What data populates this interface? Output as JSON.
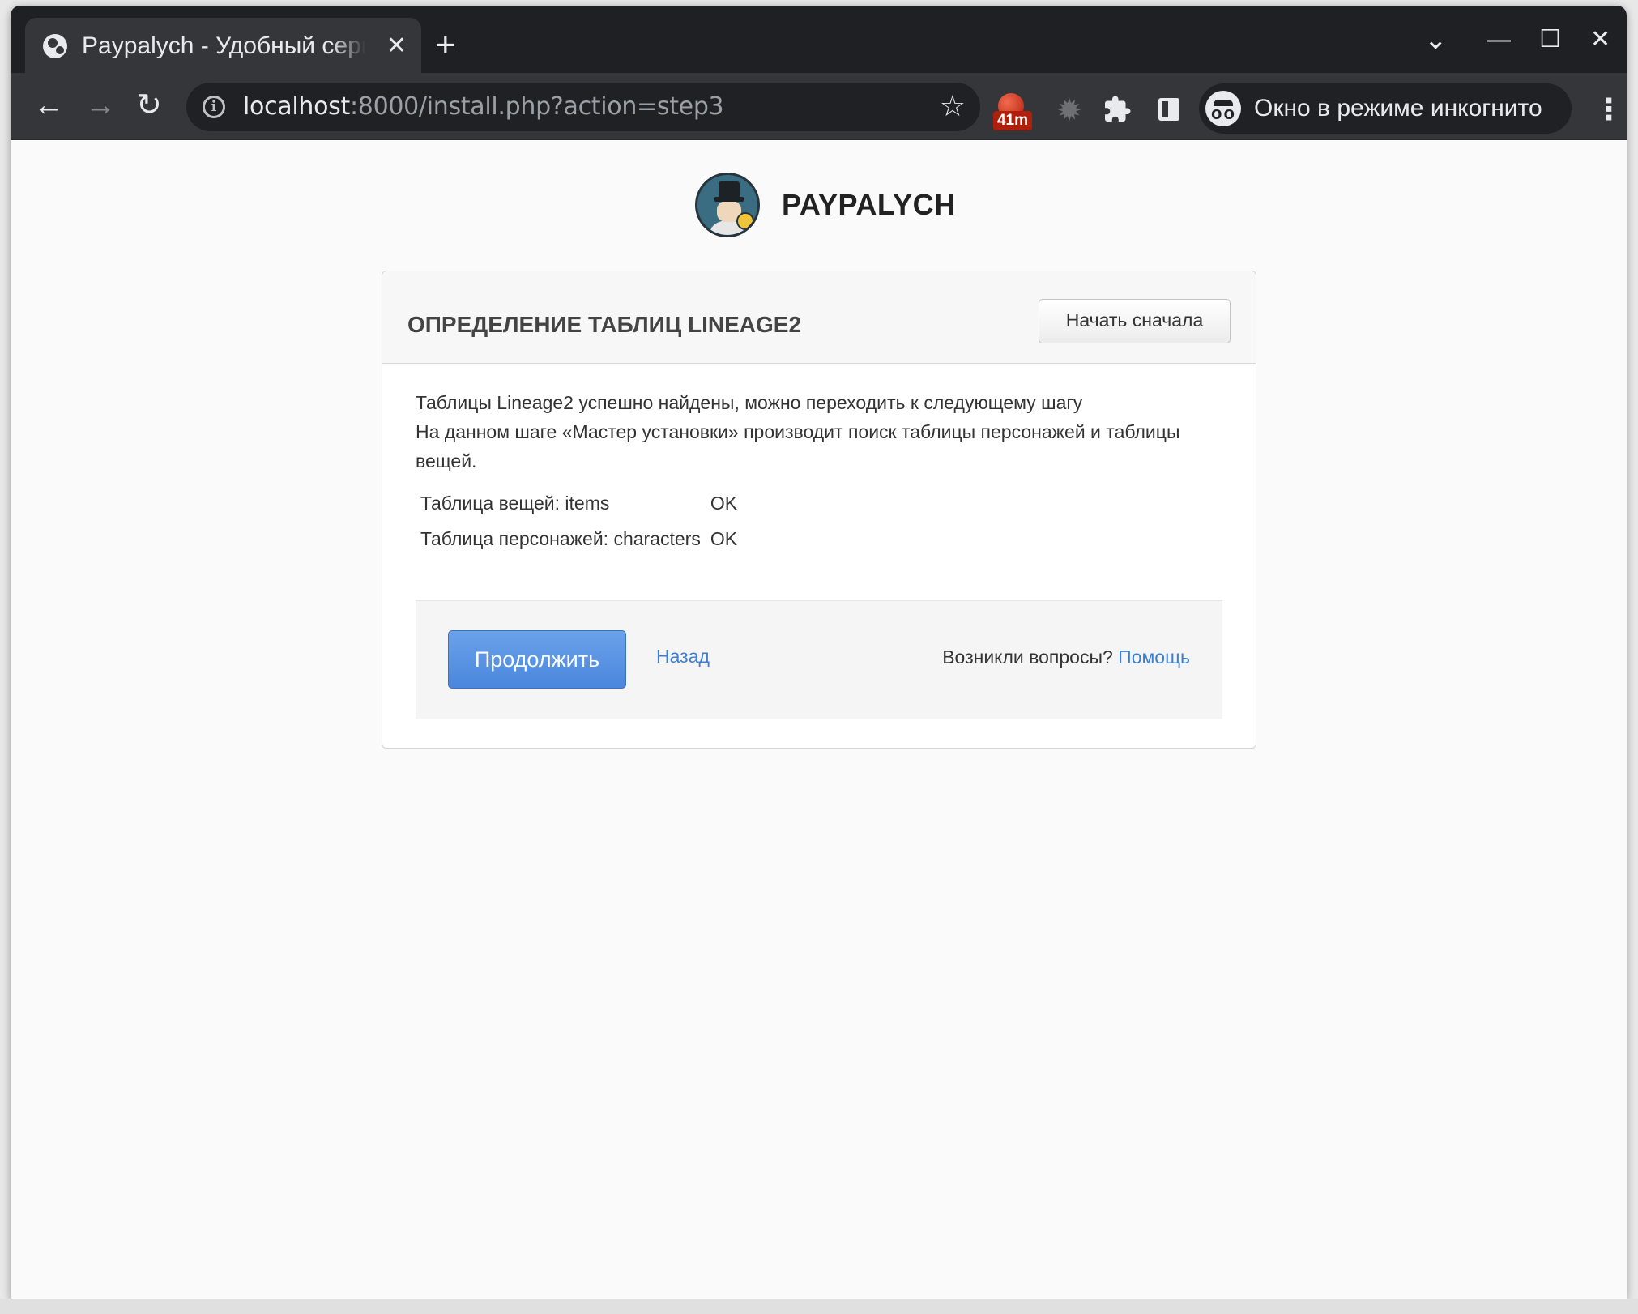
{
  "browser": {
    "tab_title": "Paypalych - Удобный сервис",
    "tab_close": "✕",
    "new_tab": "+",
    "window_controls": {
      "dropdown": "⌄",
      "minimize": "—",
      "maximize": "☐",
      "close": "✕"
    },
    "nav": {
      "back": "←",
      "forward": "→",
      "reload": "↻"
    },
    "url_host": "localhost",
    "url_rest": ":8000/install.php?action=step3",
    "star": "☆",
    "extension_badge": "41m",
    "incognito_label": "Окно в режиме инкогнито",
    "menu": "⋮"
  },
  "page": {
    "brand_name": "PAYPALYCH",
    "card": {
      "title": "ОПРЕДЕЛЕНИЕ ТАБЛИЦ LINEAGE2",
      "restart_button": "Начать сначала",
      "description_line1": "Таблицы Lineage2 успешно найдены, можно переходить к следующему шагу",
      "description_line2": "На данном шаге «Мастер установки» производит поиск таблицы персонажей и таблицы вещей.",
      "tables": [
        {
          "label": "Таблица вещей: items",
          "status": "OK"
        },
        {
          "label": "Таблица персонажей: characters",
          "status": "OK"
        }
      ],
      "continue_button": "Продолжить",
      "back_link": "Назад",
      "help_question": "Возникли вопросы?",
      "help_link": "Помощь"
    }
  },
  "colors": {
    "primary_button": "#4a86dc",
    "link": "#3b7fd0",
    "browser_dark": "#1f2023"
  }
}
